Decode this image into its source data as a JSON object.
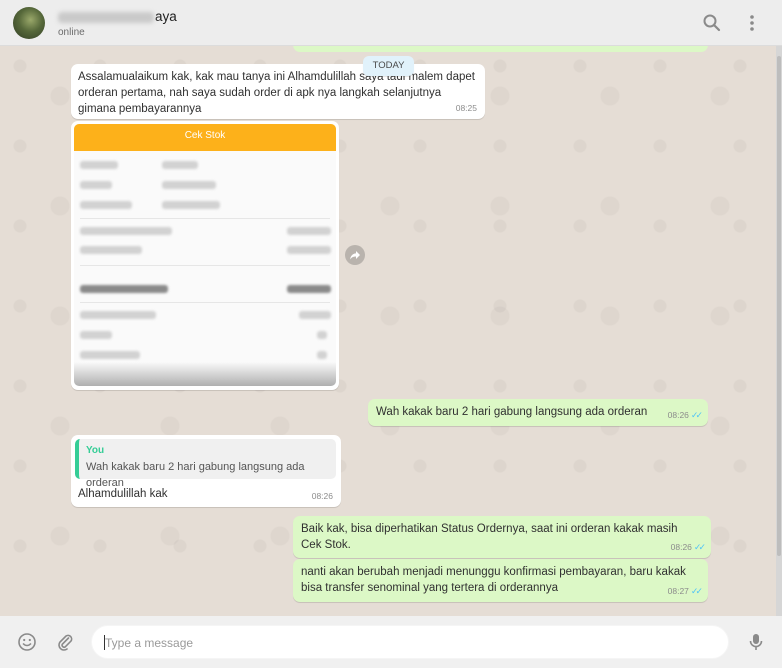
{
  "header": {
    "contact_name_visible": "aya",
    "status": "online"
  },
  "date_chip": "TODAY",
  "messages": [
    {
      "type": "incoming",
      "text": "Assalamualaikum kak, kak mau tanya ini Alhamdulillah saya tadi malem dapet orderan pertama, nah saya sudah order di apk nya langkah selanjutnya gimana pembayarannya",
      "time": "08:25"
    },
    {
      "type": "incoming-image",
      "image_title": "Cek Stok"
    },
    {
      "type": "outgoing",
      "text": "Wah kakak baru 2 hari gabung langsung ada orderan",
      "time": "08:26"
    },
    {
      "type": "incoming-reply",
      "quote_author": "You",
      "quote_text": "Wah kakak baru 2 hari gabung langsung ada orderan",
      "text": "Alhamdulillah kak",
      "time": "08:26"
    },
    {
      "type": "outgoing",
      "text": "Baik kak, bisa diperhatikan Status Ordernya, saat ini orderan kakak masih Cek Stok.",
      "time": "08:26"
    },
    {
      "type": "outgoing",
      "text": "nanti akan berubah menjadi menunggu konfirmasi pembayaran, baru kakak bisa transfer senominal yang tertera di orderannya",
      "time": "08:27"
    }
  ],
  "composer": {
    "placeholder": "Type a message"
  },
  "icons": {
    "header": [
      "search-icon",
      "menu-dots-icon"
    ],
    "footer": [
      "emoji-icon",
      "attach-icon",
      "mic-icon"
    ],
    "ticks": "double-check-icon",
    "share": "forward-icon"
  },
  "colors": {
    "outgoing_bubble": "#dcf8c6",
    "incoming_bubble": "#ffffff",
    "chat_background": "#e5ddd5",
    "image_header": "#fdb11a",
    "read_ticks": "#4fc3f7",
    "quote_accent": "#35cd96"
  }
}
